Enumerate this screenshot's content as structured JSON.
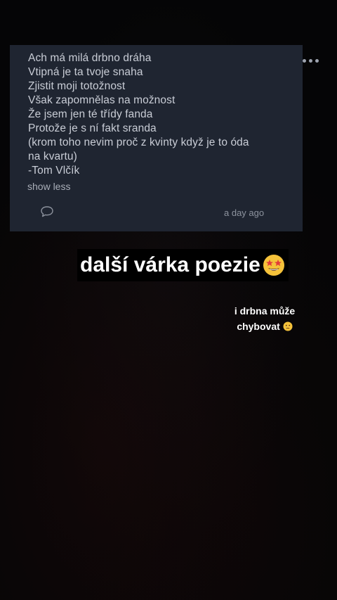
{
  "post": {
    "lines": [
      "Ach má milá drbno dráha",
      "Vtipná je ta tvoje snaha",
      "Zjistit moji totožnost",
      "Však zapomnělas na možnost",
      "Že jsem jen té třídy fanda",
      "Protože je s ní fakt sranda",
      "(krom toho nevim proč z kvinty když je to óda na kvartu)",
      "-Tom Vlčík"
    ],
    "toggle_label": "show less",
    "timestamp": "a day ago",
    "more_icon": "more-horizontal-icon",
    "comment_icon": "speech-bubble-icon"
  },
  "story": {
    "caption_main": "další várka poezie",
    "caption_main_emoji": "star-struck-emoji",
    "caption_small_line1": "i drbna  může",
    "caption_small_line2": "chybovat",
    "caption_small_emoji": "crying-face-emoji"
  }
}
